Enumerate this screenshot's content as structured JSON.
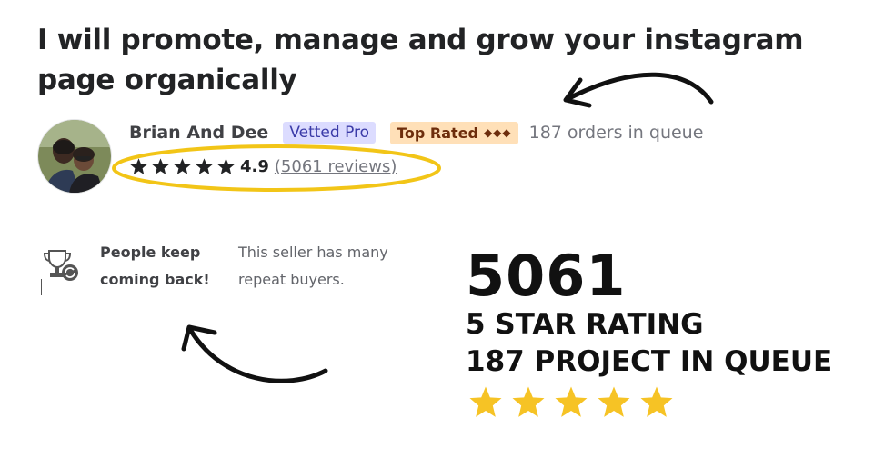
{
  "gig": {
    "title_line1": "I will promote, manage and grow your instagram",
    "title_line2": "page organically"
  },
  "seller": {
    "name": "Brian And Dee",
    "vetted_badge": "Vetted Pro",
    "top_badge": "Top Rated",
    "top_badge_diamonds": "◆◆◆",
    "orders_in_queue": "187 orders in queue",
    "rating": "4.9",
    "reviews": "(5061 reviews)",
    "star_count": 5
  },
  "highlight": {
    "title_line1": "People keep",
    "title_line2": "coming back!",
    "desc_line1": "This seller has many",
    "desc_line2": "repeat buyers."
  },
  "promo": {
    "big_number": "5061",
    "line1": "5 STAR RATING",
    "line2": "187 PROJECT IN QUEUE",
    "star_count": 5
  },
  "colors": {
    "star_dark": "#222325",
    "star_gold": "#f6c325",
    "ellipse": "#f2c517",
    "vetted_bg": "#dcdcff",
    "top_rated_bg": "#ffe0b8"
  }
}
